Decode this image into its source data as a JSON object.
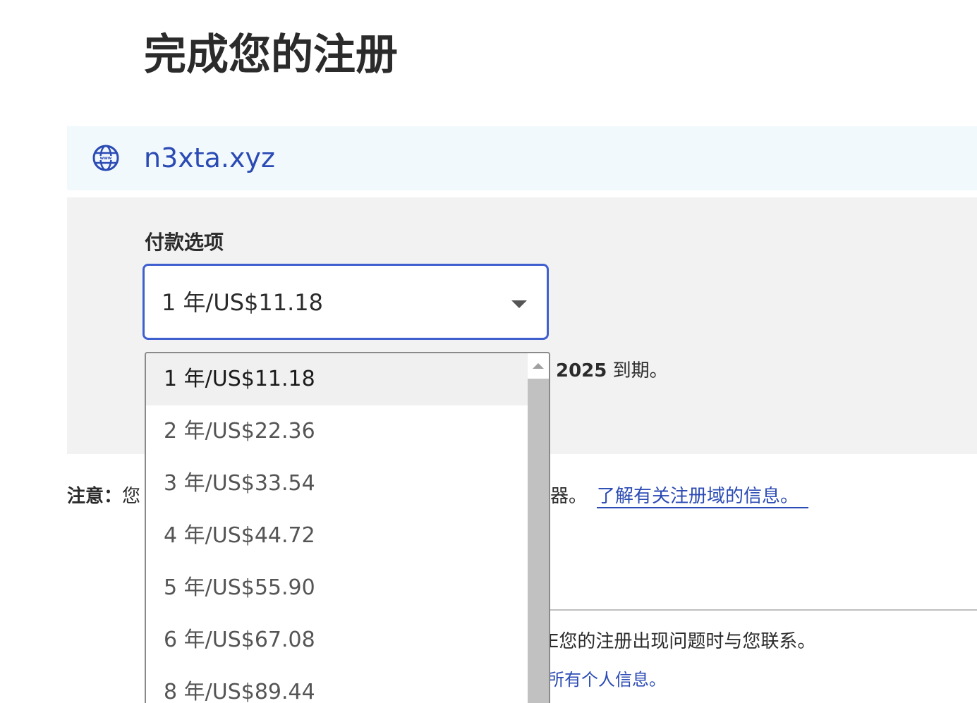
{
  "page": {
    "title": "完成您的注册"
  },
  "domain": {
    "name": "n3xta.xyz",
    "icon": "globe-www-icon"
  },
  "payment": {
    "label": "付款选项",
    "selected": "1 年/US$11.18",
    "options": [
      "1 年/US$11.18",
      "2 年/US$22.36",
      "3 年/US$33.54",
      "4 年/US$44.72",
      "5 年/US$55.90",
      "6 年/US$67.08",
      "8 年/US$89.44"
    ],
    "expiry_year": "2025",
    "expiry_suffix": " 到期。"
  },
  "notice": {
    "label": "注意：",
    "text_start": "您",
    "text_end": "器。",
    "link": "了解有关注册域的信息。"
  },
  "contact": {
    "text": "E您的注册出现问题时与您联系。",
    "privacy_link": "所有个人信息。"
  },
  "colors": {
    "accent": "#3f5fcf",
    "link": "#2b4bb4",
    "domain_bar_bg": "#f2f9fd",
    "panel_bg": "#f2f2f2"
  }
}
